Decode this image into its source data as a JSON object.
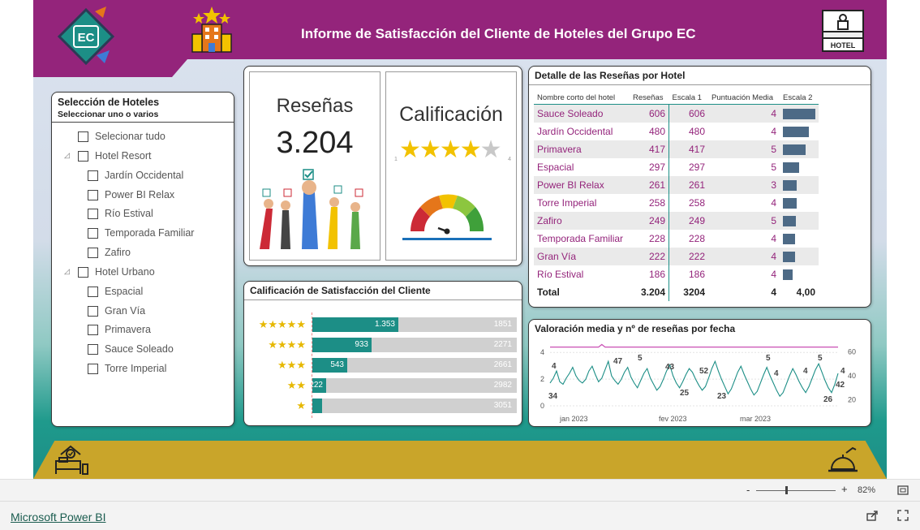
{
  "header": {
    "title": "Informe de Satisfacción del Cliente de Hoteles  del Grupo EC",
    "logo_text": "EC",
    "hotel_sign": "HOTEL"
  },
  "colors": {
    "brand": "#94247b",
    "teal": "#1c8e86",
    "gold": "#c9a52a",
    "bar": "#4d6a86",
    "star": "#e6b800"
  },
  "slicer": {
    "title": "Selección de Hoteles",
    "subtitle": "Seleccionar uno o varios",
    "select_all": "Selecionar tudo",
    "groups": [
      {
        "label": "Hotel Resort",
        "items": [
          "Jardín Occidental",
          "Power BI Relax",
          "Río Estival",
          "Temporada Familiar",
          "Zafiro"
        ]
      },
      {
        "label": "Hotel Urbano",
        "items": [
          "Espacial",
          "Gran Vía",
          "Primavera",
          "Sauce Soleado",
          "Torre Imperial"
        ]
      }
    ]
  },
  "kpi": {
    "reviews_label": "Reseñas",
    "reviews_value": "3.204",
    "rating_label": "Calificación",
    "rating_stars": 4,
    "rating_min": "1",
    "rating_max": "4"
  },
  "detail_table": {
    "title": "Detalle de las Reseñas por Hotel",
    "columns": [
      "Nombre corto del hotel",
      "Reseñas",
      "Escala 1",
      "Puntuación Media",
      "Escala 2"
    ],
    "rows": [
      {
        "name": "Sauce Soleado",
        "reviews": "606",
        "scale1": "606",
        "avg": "4",
        "bar": 606
      },
      {
        "name": "Jardín Occidental",
        "reviews": "480",
        "scale1": "480",
        "avg": "4",
        "bar": 480
      },
      {
        "name": "Primavera",
        "reviews": "417",
        "scale1": "417",
        "avg": "5",
        "bar": 417
      },
      {
        "name": "Espacial",
        "reviews": "297",
        "scale1": "297",
        "avg": "5",
        "bar": 297
      },
      {
        "name": "Power BI Relax",
        "reviews": "261",
        "scale1": "261",
        "avg": "3",
        "bar": 261
      },
      {
        "name": "Torre Imperial",
        "reviews": "258",
        "scale1": "258",
        "avg": "4",
        "bar": 258
      },
      {
        "name": "Zafiro",
        "reviews": "249",
        "scale1": "249",
        "avg": "5",
        "bar": 249
      },
      {
        "name": "Temporada Familiar",
        "reviews": "228",
        "scale1": "228",
        "avg": "4",
        "bar": 228
      },
      {
        "name": "Gran Vía",
        "reviews": "222",
        "scale1": "222",
        "avg": "4",
        "bar": 222
      },
      {
        "name": "Río Estival",
        "reviews": "186",
        "scale1": "186",
        "avg": "4",
        "bar": 186
      }
    ],
    "total": {
      "label": "Total",
      "reviews": "3.204",
      "scale1": "3204",
      "avg": "4",
      "scale2": "4,00"
    }
  },
  "rating_chart": {
    "title": "Calificación de Satisfacción del Cliente",
    "rows": [
      {
        "stars": "★★★★★",
        "value": 1353,
        "value_label": "1.353",
        "total": "1851"
      },
      {
        "stars": "★★★★",
        "value": 933,
        "value_label": "933",
        "total": "2271"
      },
      {
        "stars": "★★★",
        "value": 543,
        "value_label": "543",
        "total": "2661"
      },
      {
        "stars": "★★",
        "value": 222,
        "value_label": "222",
        "total": "2982"
      },
      {
        "stars": "★",
        "value": 153,
        "value_label": "",
        "total": "3051"
      }
    ]
  },
  "chart_data": {
    "type": "line",
    "title": "Valoración media y nº de reseñas por fecha",
    "x_ticks": [
      "jan 2023",
      "fev 2023",
      "mar 2023"
    ],
    "y_left_ticks": [
      "4",
      "2",
      "0"
    ],
    "y_right_ticks": [
      "60",
      "40",
      "20"
    ],
    "y_left_lim": [
      0,
      4.5
    ],
    "y_right_lim": [
      15,
      65
    ],
    "series": [
      {
        "axis": "left",
        "values": [
          4.4,
          4.4,
          4.4,
          4.4,
          4.4,
          4.4,
          4.4,
          4.4,
          4.4,
          4.4,
          4.4,
          4.4,
          4.4,
          4.4,
          4.4,
          4.4,
          4.6,
          4.4,
          4.4,
          4.4,
          4.4,
          4.4,
          4.4,
          4.4,
          4.4,
          4.4,
          4.4,
          4.4,
          4.4,
          4.4,
          4.4,
          4.4,
          4.4,
          4.4,
          4.4,
          4.4,
          4.4,
          4.4,
          4.4,
          4.4,
          4.4,
          4.4,
          4.4,
          4.4,
          4.4,
          4.4,
          4.4,
          4.4,
          4.4,
          4.4,
          4.4,
          4.4,
          4.4,
          4.4,
          4.4,
          4.4,
          4.4,
          4.4,
          4.4,
          4.4,
          4.4,
          4.4,
          4.4,
          4.4,
          4.4,
          4.4,
          4.4,
          4.4,
          4.4,
          4.4,
          4.4,
          4.4,
          4.4,
          4.4,
          4.4,
          4.4,
          4.4,
          4.4,
          4.4,
          4.4,
          4.4,
          4.4,
          4.4,
          4.4,
          4.4,
          4.4,
          4.4,
          4.4,
          4.4,
          4.4
        ]
      },
      {
        "axis": "right",
        "values": [
          34,
          38,
          44,
          35,
          33,
          38,
          42,
          47,
          40,
          36,
          34,
          37,
          44,
          48,
          41,
          35,
          38,
          45,
          52,
          40,
          36,
          33,
          37,
          43,
          47,
          39,
          34,
          30,
          36,
          42,
          46,
          38,
          33,
          28,
          31,
          37,
          44,
          49,
          40,
          34,
          30,
          35,
          41,
          46,
          43,
          37,
          32,
          28,
          31,
          38,
          46,
          52,
          44,
          37,
          31,
          25,
          29,
          36,
          43,
          48,
          41,
          35,
          29,
          24,
          27,
          34,
          41,
          47,
          40,
          34,
          28,
          23,
          26,
          33,
          40,
          46,
          41,
          35,
          30,
          26,
          31,
          38,
          45,
          50,
          43,
          36,
          30,
          26,
          33,
          42
        ]
      }
    ],
    "labels": [
      "4",
      "47",
      "5",
      "43",
      "52",
      "5",
      "4",
      "4",
      "5",
      "4",
      "42",
      "34",
      "25",
      "23",
      "26"
    ]
  },
  "status": {
    "zoom": "82%",
    "pbi_link": "Microsoft Power BI"
  }
}
